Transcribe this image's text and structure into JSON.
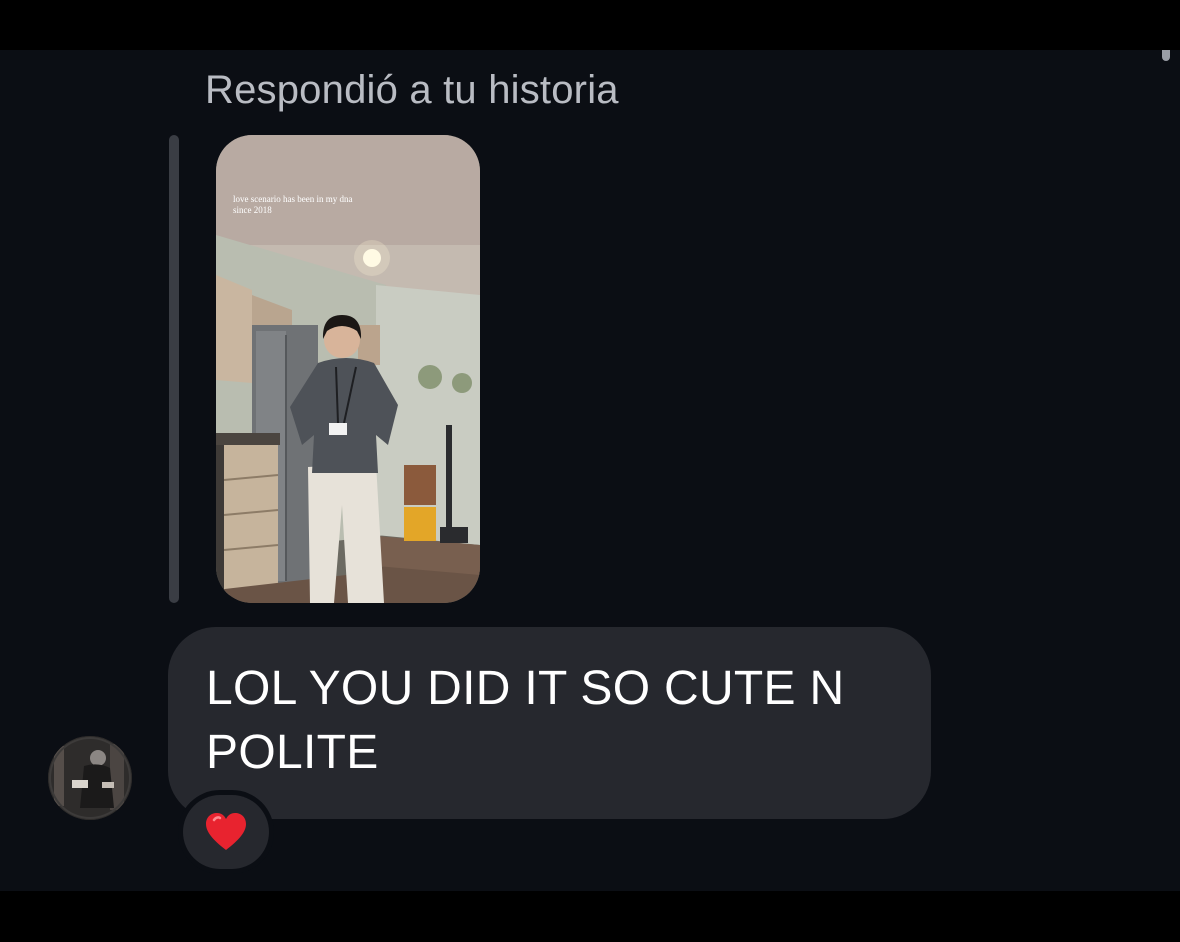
{
  "thread": {
    "reply_header": "Respondió a tu historia",
    "story": {
      "caption": "love scenario has been in my dna since 2018",
      "image": "story-photo-kitchen"
    },
    "message": {
      "text": "LOL YOU DID IT SO CUTE N POLITE",
      "reaction": "heart-icon",
      "reaction_color": "#e8232f"
    },
    "avatar": "avatar-photo"
  },
  "colors": {
    "background": "#0b0e14",
    "bubble": "#26282e",
    "header_text": "#b9bcc3",
    "message_text": "#ffffff"
  }
}
